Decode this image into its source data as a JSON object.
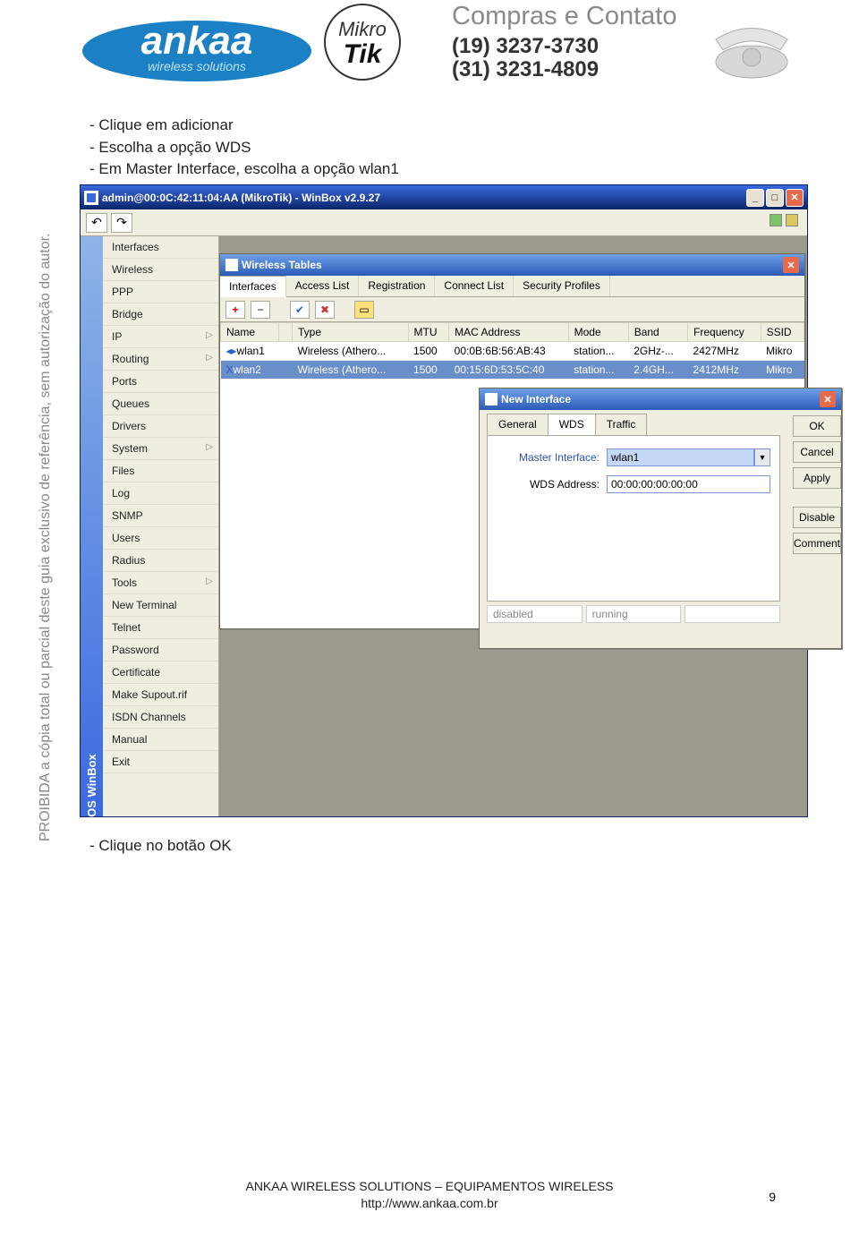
{
  "header": {
    "ankaa": "ankaa",
    "ankaa_tag": "wireless solutions",
    "mikrotik_top": "Mikro",
    "mikrotik_bottom": "Tik",
    "contact_title": "Compras e Contato",
    "phone1": "(19) 3237-3730",
    "phone2": "(31) 3231-4809"
  },
  "watermark": "PROIBIDA a cópia total ou parcial deste guia exclusivo de referência, sem autorização do autor.",
  "instructions": {
    "line1": "- Clique em adicionar",
    "line2": "- Escolha a opção WDS",
    "line3": "- Em Master Interface, escolha a opção wlan1"
  },
  "winbox": {
    "title": "admin@00:0C:42:11:04:AA (MikroTik) - WinBox v2.9.27",
    "sidebar_label": "RouterOS WinBox",
    "menu": [
      "Interfaces",
      "Wireless",
      "PPP",
      "Bridge",
      "IP",
      "Routing",
      "Ports",
      "Queues",
      "Drivers",
      "System",
      "Files",
      "Log",
      "SNMP",
      "Users",
      "Radius",
      "Tools",
      "New Terminal",
      "Telnet",
      "Password",
      "Certificate",
      "Make Supout.rif",
      "ISDN Channels",
      "Manual",
      "Exit"
    ],
    "menu_submenu_idx": [
      4,
      5,
      9,
      15
    ],
    "wireless_tables": {
      "title": "Wireless Tables",
      "tabs": [
        "Interfaces",
        "Access List",
        "Registration",
        "Connect List",
        "Security Profiles"
      ],
      "columns": [
        "Name",
        "",
        "Type",
        "MTU",
        "MAC Address",
        "Mode",
        "Band",
        "Frequency",
        "SSID"
      ],
      "rows": [
        {
          "name": "wlan1",
          "icon": "◂▸",
          "type": "Wireless (Athero...",
          "mtu": "1500",
          "mac": "00:0B:6B:56:AB:43",
          "mode": "station...",
          "band": "2GHz-...",
          "freq": "2427MHz",
          "ssid": "Mikro"
        },
        {
          "name": "wlan2",
          "icon": "X",
          "type": "Wireless (Athero...",
          "mtu": "1500",
          "mac": "00:15:6D:53:5C:40",
          "mode": "station...",
          "band": "2.4GH...",
          "freq": "2412MHz",
          "ssid": "Mikro"
        }
      ]
    },
    "new_interface": {
      "title": "New Interface",
      "tabs": [
        "General",
        "WDS",
        "Traffic"
      ],
      "master_label": "Master Interface:",
      "master_value": "wlan1",
      "wds_label": "WDS Address:",
      "wds_value": "00:00:00:00:00:00",
      "buttons": [
        "OK",
        "Cancel",
        "Apply",
        "Disable",
        "Comment"
      ],
      "status": [
        "disabled",
        "running",
        ""
      ]
    }
  },
  "after_text": "- Clique no botão OK",
  "footer": {
    "line1": "ANKAA WIRELESS SOLUTIONS – EQUIPAMENTOS WIRELESS",
    "line2": "http://www.ankaa.com.br",
    "page": "9"
  }
}
